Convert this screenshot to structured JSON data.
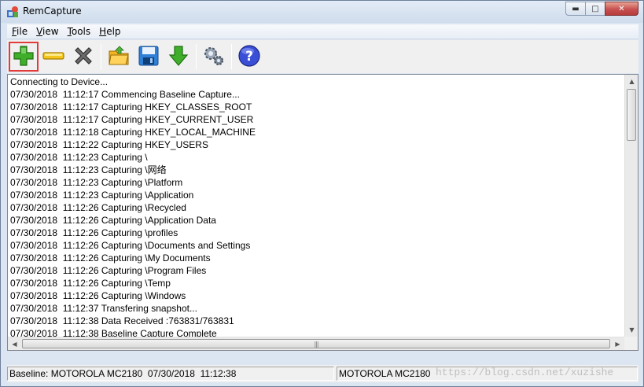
{
  "window": {
    "title": "RemCapture"
  },
  "menu": [
    {
      "underline": "F",
      "rest": "ile"
    },
    {
      "underline": "V",
      "rest": "iew"
    },
    {
      "underline": "T",
      "rest": "ools"
    },
    {
      "underline": "H",
      "rest": "elp"
    }
  ],
  "toolbar": {
    "buttons": [
      "add-icon",
      "minus-icon",
      "delete-icon",
      "open-folder-icon",
      "save-icon",
      "download-icon",
      "settings-icon",
      "help-icon"
    ],
    "accent_highlight": "#e23b3b"
  },
  "log": [
    "Connecting to Device...",
    "07/30/2018  11:12:17 Commencing Baseline Capture...",
    "07/30/2018  11:12:17 Capturing HKEY_CLASSES_ROOT",
    "07/30/2018  11:12:17 Capturing HKEY_CURRENT_USER",
    "07/30/2018  11:12:18 Capturing HKEY_LOCAL_MACHINE",
    "07/30/2018  11:12:22 Capturing HKEY_USERS",
    "07/30/2018  11:12:23 Capturing \\",
    "07/30/2018  11:12:23 Capturing \\网络",
    "07/30/2018  11:12:23 Capturing \\Platform",
    "07/30/2018  11:12:23 Capturing \\Application",
    "07/30/2018  11:12:26 Capturing \\Recycled",
    "07/30/2018  11:12:26 Capturing \\Application Data",
    "07/30/2018  11:12:26 Capturing \\profiles",
    "07/30/2018  11:12:26 Capturing \\Documents and Settings",
    "07/30/2018  11:12:26 Capturing \\My Documents",
    "07/30/2018  11:12:26 Capturing \\Program Files",
    "07/30/2018  11:12:26 Capturing \\Temp",
    "07/30/2018  11:12:26 Capturing \\Windows",
    "07/30/2018  11:12:37 Transfering snapshot...",
    "07/30/2018  11:12:38 Data Received :763831/763831",
    "07/30/2018  11:12:38 Baseline Capture Complete"
  ],
  "status": {
    "baseline": "Baseline: MOTOROLA MC2180  07/30/2018  11:12:38",
    "device": "MOTOROLA MC2180"
  },
  "watermark": "https://blog.csdn.net/xuzishe"
}
